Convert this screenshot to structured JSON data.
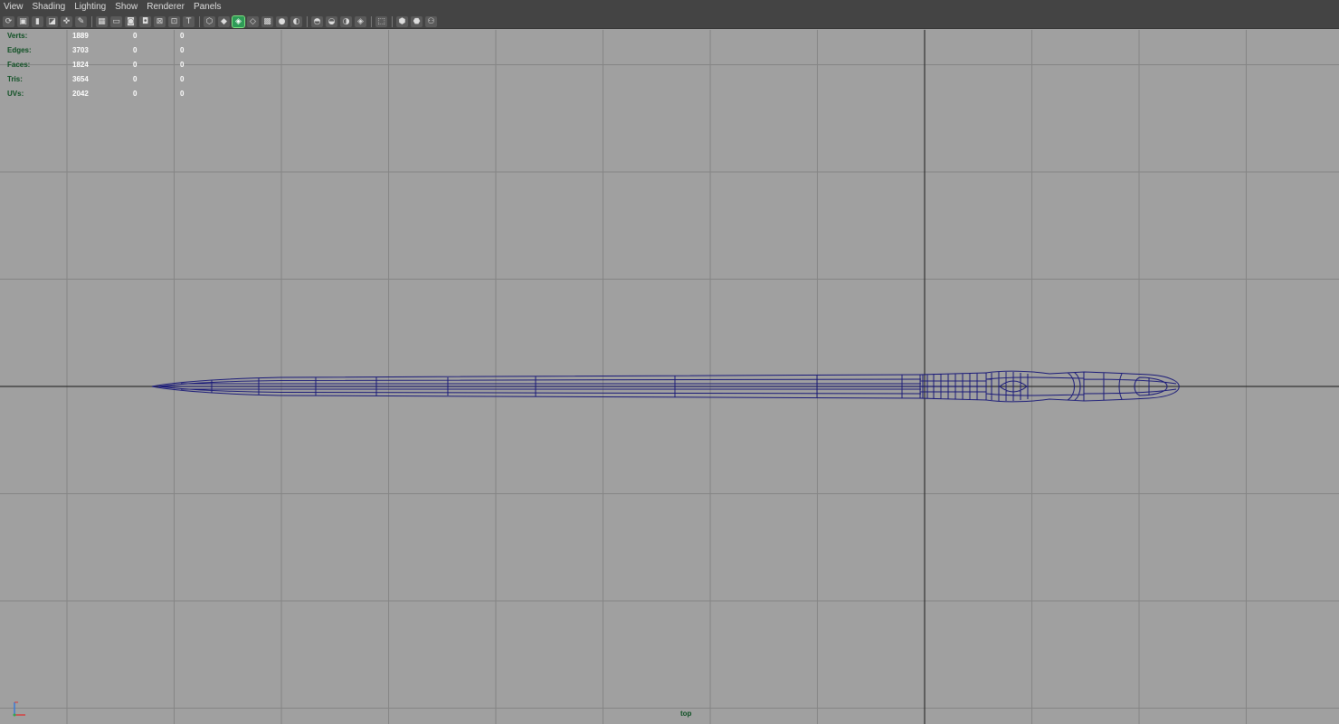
{
  "menu": {
    "items": [
      "View",
      "Shading",
      "Lighting",
      "Show",
      "Renderer",
      "Panels"
    ]
  },
  "toolbar": {
    "groups": [
      [
        {
          "icon": "select-camera-icon",
          "glyph": "⟳"
        },
        {
          "icon": "camera-attributes-icon",
          "glyph": "▣"
        },
        {
          "icon": "bookmarks-icon",
          "glyph": "▮"
        },
        {
          "icon": "image-plane-icon",
          "glyph": "◪"
        },
        {
          "icon": "two-d-pan-zoom-icon",
          "glyph": "✜"
        },
        {
          "icon": "grease-pencil-icon",
          "glyph": "✎"
        }
      ],
      [
        {
          "icon": "grid-toggle-icon",
          "glyph": "▦"
        },
        {
          "icon": "film-gate-icon",
          "glyph": "▭"
        },
        {
          "icon": "resolution-gate-icon",
          "glyph": "◙"
        },
        {
          "icon": "gate-mask-icon",
          "glyph": "◘"
        },
        {
          "icon": "field-chart-icon",
          "glyph": "⊠"
        },
        {
          "icon": "safe-action-icon",
          "glyph": "⊡"
        },
        {
          "icon": "safe-title-icon",
          "glyph": "T"
        }
      ],
      [
        {
          "icon": "wireframe-icon",
          "glyph": "⬡"
        },
        {
          "icon": "smooth-shade-icon",
          "glyph": "◆"
        },
        {
          "icon": "wireframe-on-shaded-icon",
          "glyph": "◈",
          "active": true
        },
        {
          "icon": "xray-icon",
          "glyph": "◇"
        },
        {
          "icon": "textured-icon",
          "glyph": "▩"
        },
        {
          "icon": "use-all-lights-icon",
          "glyph": "●"
        },
        {
          "icon": "shadows-icon",
          "glyph": "◐"
        }
      ],
      [
        {
          "icon": "screen-space-ao-icon",
          "glyph": "◓"
        },
        {
          "icon": "motion-blur-icon",
          "glyph": "◒"
        },
        {
          "icon": "multisample-aa-icon",
          "glyph": "◑"
        },
        {
          "icon": "depth-of-field-icon",
          "glyph": "◈"
        }
      ],
      [
        {
          "icon": "isolate-select-icon",
          "glyph": "⬚"
        }
      ],
      [
        {
          "icon": "xray-joints-icon",
          "glyph": "⬢"
        },
        {
          "icon": "xray-active-components-icon",
          "glyph": "⬣"
        },
        {
          "icon": "hud-toggle-icon",
          "glyph": "⚇"
        }
      ]
    ]
  },
  "hud": {
    "rows": [
      {
        "label": "Verts:",
        "v1": "1889",
        "v2": "0",
        "v3": "0"
      },
      {
        "label": "Edges:",
        "v1": "3703",
        "v2": "0",
        "v3": "0"
      },
      {
        "label": "Faces:",
        "v1": "1824",
        "v2": "0",
        "v3": "0"
      },
      {
        "label": "Tris:",
        "v1": "3654",
        "v2": "0",
        "v3": "0"
      },
      {
        "label": "UVs:",
        "v1": "2042",
        "v2": "0",
        "v3": "0"
      }
    ]
  },
  "viewport": {
    "camera": "top",
    "colors": {
      "background": "#a0a0a0",
      "grid": "#858585",
      "axis": "#333333",
      "wireframe": "#1a1a78"
    }
  }
}
